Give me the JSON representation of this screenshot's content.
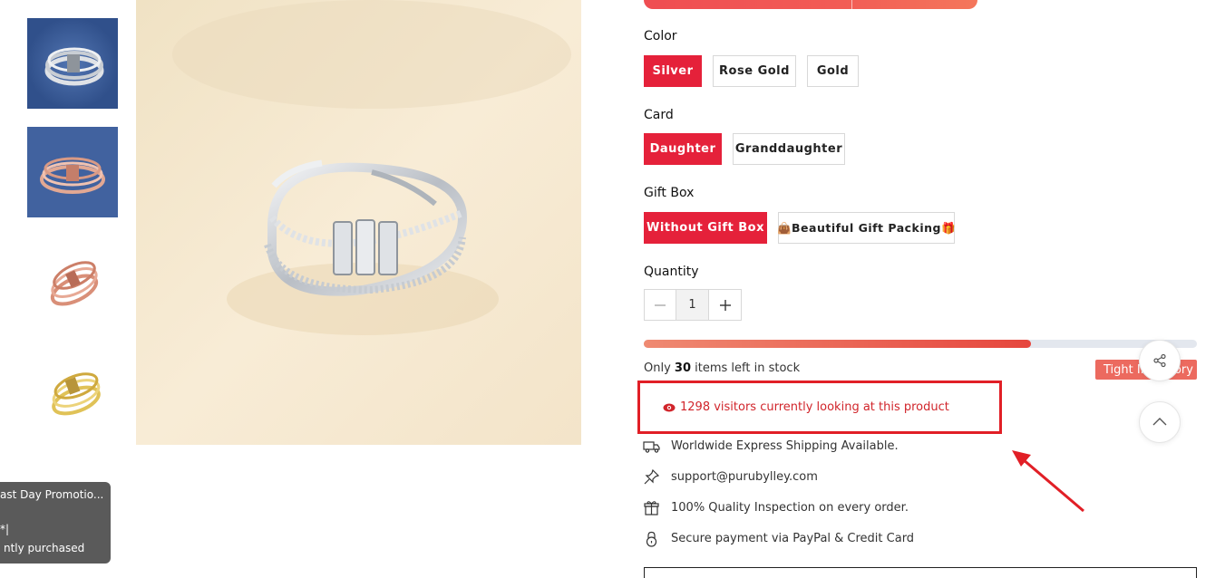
{
  "thumbnails": [
    {
      "name": "thumb-silver-ring",
      "colors": {
        "bg": "#3b5f9f",
        "metal": "#d6d9dd"
      }
    },
    {
      "name": "thumb-rose-gold-ring-blue",
      "colors": {
        "bg": "#41629f",
        "metal": "#d99a85"
      }
    },
    {
      "name": "thumb-rose-gold-ring",
      "colors": {
        "bg": "#ffffff",
        "metal": "#d98f78"
      }
    },
    {
      "name": "thumb-gold-ring",
      "colors": {
        "bg": "#ffffff",
        "metal": "#e0c257"
      }
    }
  ],
  "toast": {
    "line1": "ast Day Promotio...",
    "line2": "*|",
    "line3": "ntly purchased"
  },
  "options": {
    "color": {
      "label": "Color",
      "values": [
        "Silver",
        "Rose Gold",
        "Gold"
      ],
      "selected": "Silver"
    },
    "card": {
      "label": "Card",
      "values": [
        "Daughter",
        "Granddaughter"
      ],
      "selected": "Daughter"
    },
    "gift_box": {
      "label": "Gift Box",
      "values": [
        "Without Gift Box",
        "👜Beautiful Gift Packing🎁"
      ],
      "selected": "Without Gift Box"
    }
  },
  "quantity": {
    "label": "Quantity",
    "value": "1",
    "minus": "−",
    "plus": "+"
  },
  "stock": {
    "progress_percent": 70,
    "text_prefix": "Only ",
    "count": "30",
    "text_suffix": " items left in stock",
    "badge": "Tight Inventory"
  },
  "visitors": {
    "count": "1298",
    "text": "1298 visitors currently looking at this product"
  },
  "features": [
    {
      "icon": "truck-icon",
      "text": "Worldwide Express Shipping Available."
    },
    {
      "icon": "pin-icon",
      "text": "support@purubylley.com"
    },
    {
      "icon": "gift-box-icon",
      "text": "100% Quality Inspection on every order."
    },
    {
      "icon": "lock-icon",
      "text": "Secure payment via PayPal & Credit Card"
    }
  ],
  "colors": {
    "accent": "#e5213a",
    "annotation": "#e11f26",
    "badge": "#ec6a5f"
  }
}
